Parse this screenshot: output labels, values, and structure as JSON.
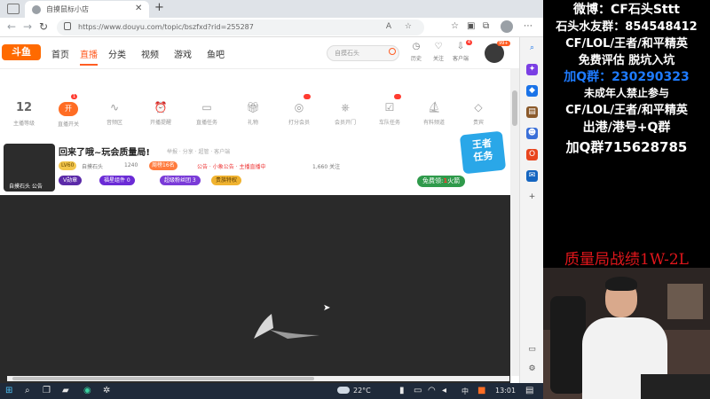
{
  "browser": {
    "tab_title": "自摸鼠标小店",
    "url": "https://www.douyu.com/topic/bszfxd?rid=255287"
  },
  "site": {
    "logo_text": "斗鱼",
    "nav": [
      {
        "label": "首页"
      },
      {
        "label": "直播"
      },
      {
        "label": "分类"
      },
      {
        "label": "视频"
      },
      {
        "label": "游戏"
      },
      {
        "label": "鱼吧"
      }
    ],
    "search_placeholder": "自摸石头",
    "header_items": [
      {
        "label": "历史",
        "icon": "clock-icon"
      },
      {
        "label": "关注",
        "icon": "heart-icon"
      },
      {
        "label": "客户端",
        "icon": "download-icon",
        "badge": "4"
      }
    ],
    "avatar_badge": "99+"
  },
  "icon_strip": [
    {
      "value": "12",
      "label": "主播等级"
    },
    {
      "label": "直播开关",
      "badge": "1"
    },
    {
      "label": "音频区"
    },
    {
      "label": "开播提醒"
    },
    {
      "label": "直播任务"
    },
    {
      "label": "礼物"
    },
    {
      "label": "打分会员"
    },
    {
      "label": "会员开门"
    },
    {
      "label": "车队任务"
    },
    {
      "label": "有料频道"
    },
    {
      "label": "贵宾"
    }
  ],
  "stream": {
    "title": "回来了哦~玩会质量局!",
    "meta": "举报  ·  分享  ·  超管  ·  客户端",
    "tag_level": "LV60",
    "streamer_name": "自摸石头",
    "views": "1240",
    "tag_rank": "周榜16名",
    "notice": "公告 · 小象公告 · 主播直播中",
    "followers": "1,660 关注",
    "buttons": [
      {
        "label": "V勋章",
        "color": "#5b2aa8"
      },
      {
        "label": "福星组件 0",
        "color": "#6b2bd6"
      },
      {
        "label": "超级粉丝团 3",
        "color": "#7a3bd8"
      },
      {
        "label": "贵族特权",
        "color": "#f0b330"
      }
    ],
    "badge_graphic": "王者\n任务",
    "gift_prefix": "免费领:",
    "gift_count": "1",
    "gift_suffix": "火箭",
    "avatar_label": "自摸石头 公告"
  },
  "taskbar": {
    "temperature": "22°C",
    "lang": "中",
    "time": "13:01"
  },
  "overlay": {
    "lines": [
      "微博：CF石头Sttt",
      "石头水友群：854548412",
      "CF/LOL/王者/和平精英",
      "免费评估 脱坑入坑",
      "加Q群：230290323",
      "未成年人禁止参与",
      "CF/LOL/王者/和平精英",
      "出港/港号+Q群",
      "加Q群715628785"
    ],
    "record": "质量局战绩1W-2L"
  }
}
